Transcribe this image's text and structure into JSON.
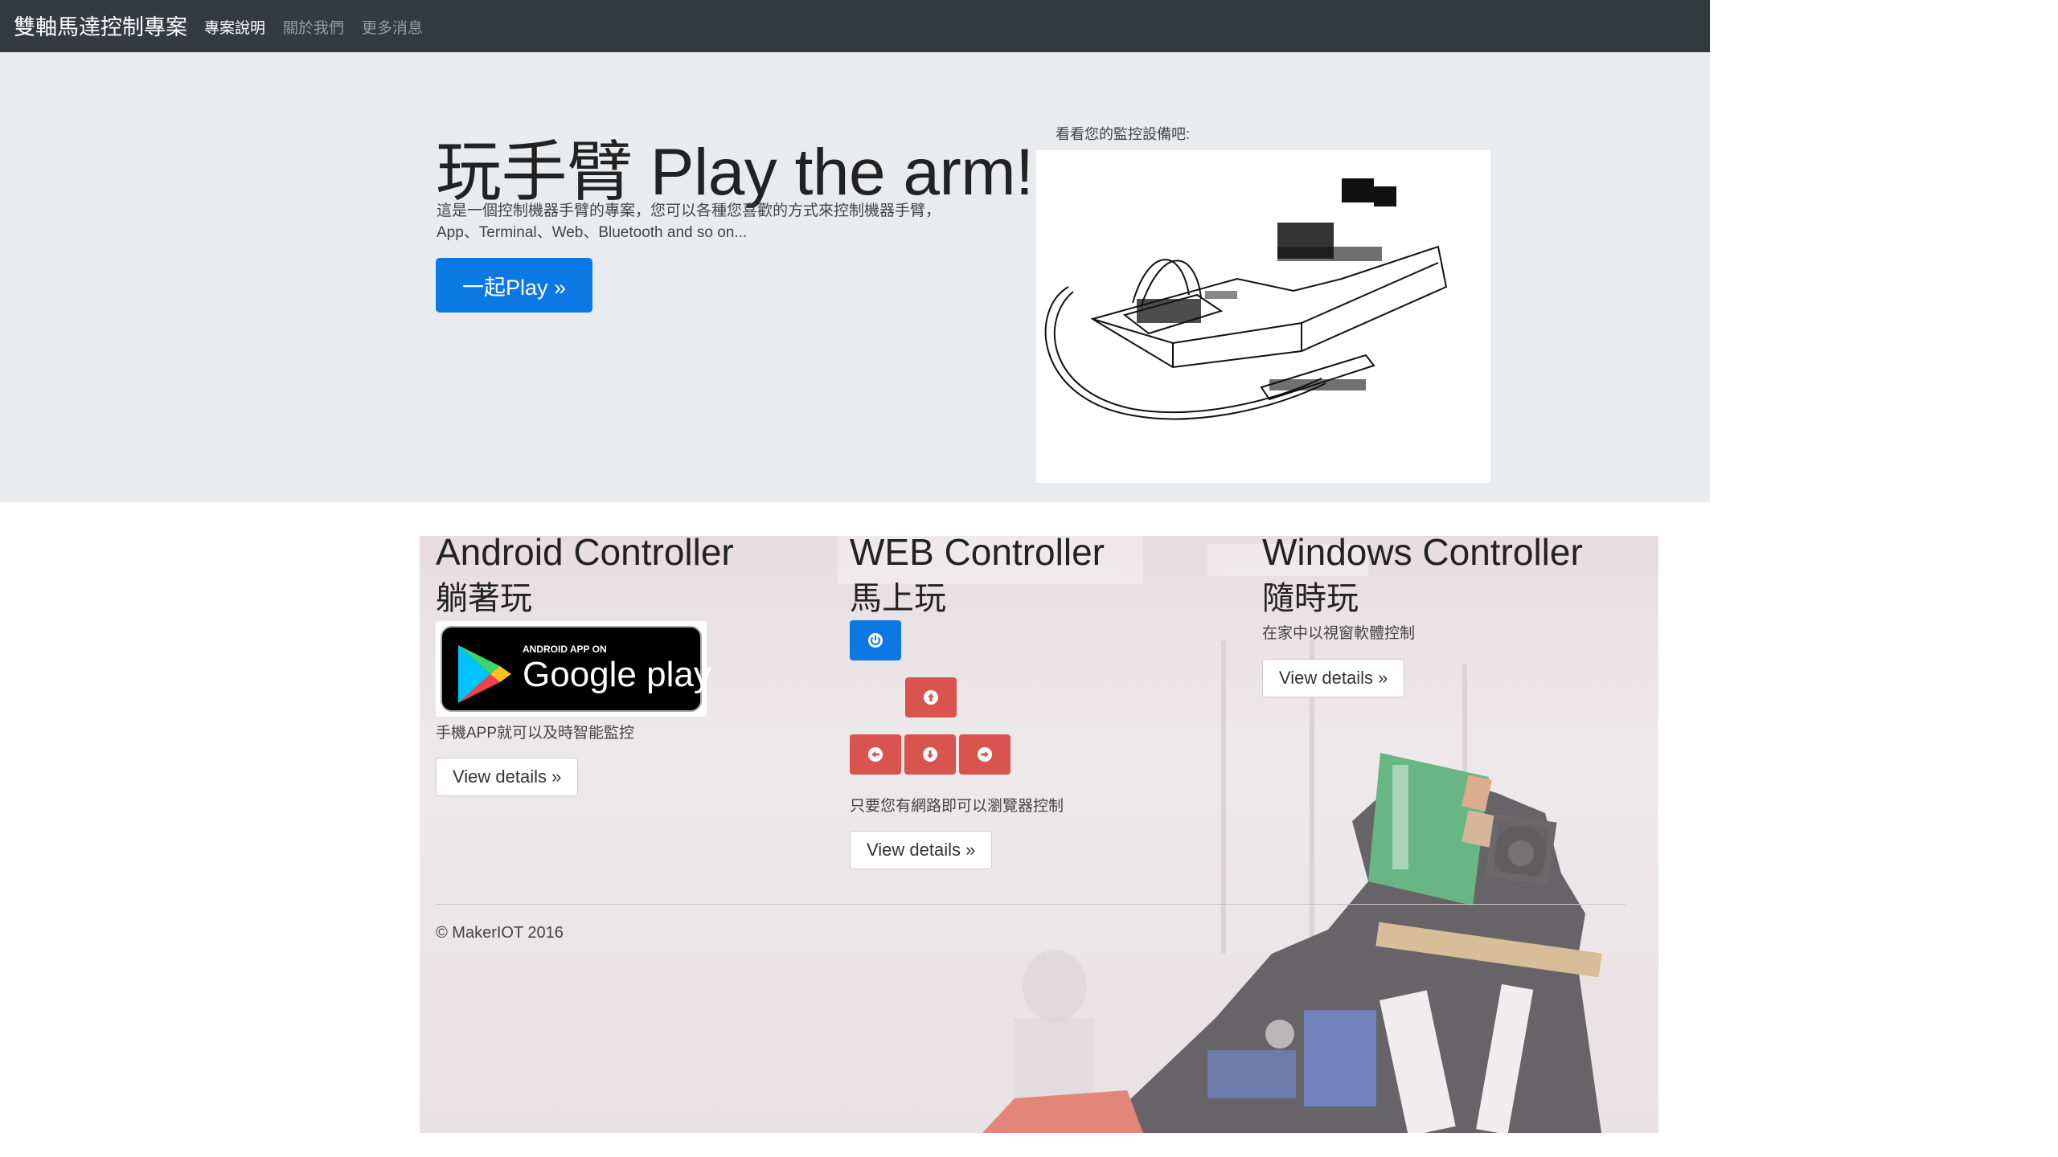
{
  "navbar": {
    "brand": "雙軸馬達控制專案",
    "links": [
      "專案說明",
      "關於我們",
      "更多消息"
    ]
  },
  "jumbotron": {
    "title": "玩手臂 Play the arm!",
    "description_line1": "這是一個控制機器手臂的專案，您可以各種您喜歡的方式來控制機器手臂，",
    "description_line2": "App、Terminal、Web、Bluetooth and so on...",
    "button": "一起Play »",
    "camera_caption": "看看您的監控設備吧:"
  },
  "columns": {
    "android": {
      "title": "Android Controller",
      "subtitle": "躺著玩",
      "badge_small": "ANDROID APP ON",
      "badge_big": "Google play",
      "text": "手機APP就可以及時智能監控",
      "button": "View details »"
    },
    "web": {
      "title": "WEB Controller",
      "subtitle": "馬上玩",
      "text": "只要您有網路即可以瀏覽器控制",
      "button": "View details »",
      "controls": [
        "power-icon",
        "arrow-up-icon",
        "arrow-left-icon",
        "arrow-down-icon",
        "arrow-right-icon"
      ]
    },
    "windows": {
      "title": "Windows Controller",
      "subtitle": "隨時玩",
      "text": "在家中以視窗軟體控制",
      "button": "View details »"
    }
  },
  "footer": {
    "text": "© MakerIOT 2016"
  },
  "colors": {
    "navbar": "#343a40",
    "primary": "#0b78e3",
    "danger": "#d9534f",
    "jumbotron": "#e9ecef"
  }
}
